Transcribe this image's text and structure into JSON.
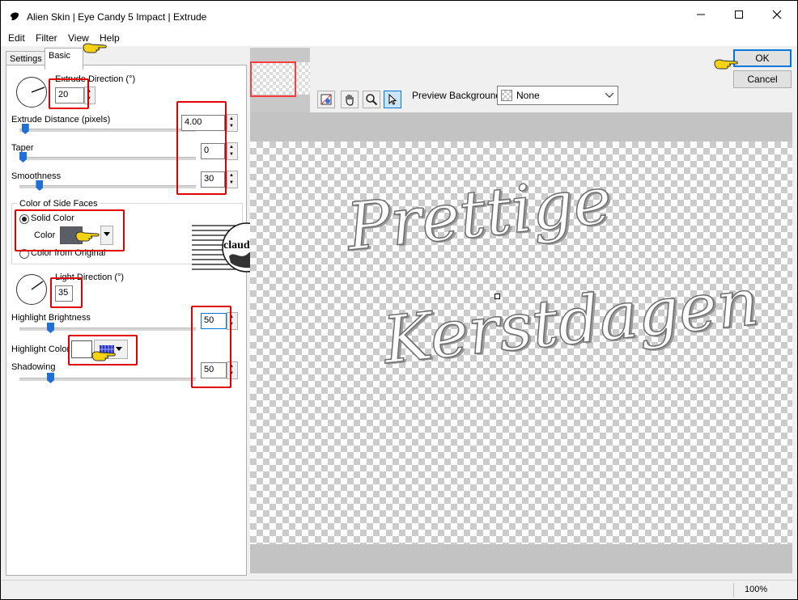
{
  "window": {
    "title": "Alien Skin | Eye Candy 5 Impact | Extrude"
  },
  "menu": [
    "Edit",
    "Filter",
    "View",
    "Help"
  ],
  "tabs": {
    "settings": "Settings",
    "basic": "Basic"
  },
  "basic": {
    "extrude_direction_label": "Extrude Direction (°)",
    "extrude_direction_value": "20",
    "extrude_distance_label": "Extrude Distance (pixels)",
    "extrude_distance_value": "4.00",
    "taper_label": "Taper",
    "taper_value": "0",
    "smoothness_label": "Smoothness",
    "smoothness_value": "30",
    "side_faces_group": "Color of Side Faces",
    "solid_color_label": "Solid Color",
    "color_label": "Color",
    "color_from_original_label": "Color from Original",
    "light_direction_label": "Light Direction (°)",
    "light_direction_value": "35",
    "highlight_brightness_label": "Highlight Brightness",
    "highlight_brightness_value": "50",
    "highlight_color_label": "Highlight Color",
    "shadowing_label": "Shadowing",
    "shadowing_value": "50",
    "side_color": "#5a5e66",
    "highlight_color": "#ffffff",
    "slider_levels": {
      "extrude_distance": 0.04,
      "taper": 0.0,
      "smoothness": 0.3,
      "highlight_brightness": 0.5,
      "shadowing": 0.5
    }
  },
  "actions": {
    "ok": "OK",
    "cancel": "Cancel"
  },
  "preview": {
    "background_label": "Preview Background:",
    "background_value": "None",
    "text_line1": "Prettige",
    "text_line2": "Kerstdagen"
  },
  "watermark": {
    "text": "claudia"
  },
  "status": {
    "zoom": "100%"
  },
  "colors": {
    "annotation_red": "#e00000",
    "accent_blue": "#1f6fd4"
  }
}
